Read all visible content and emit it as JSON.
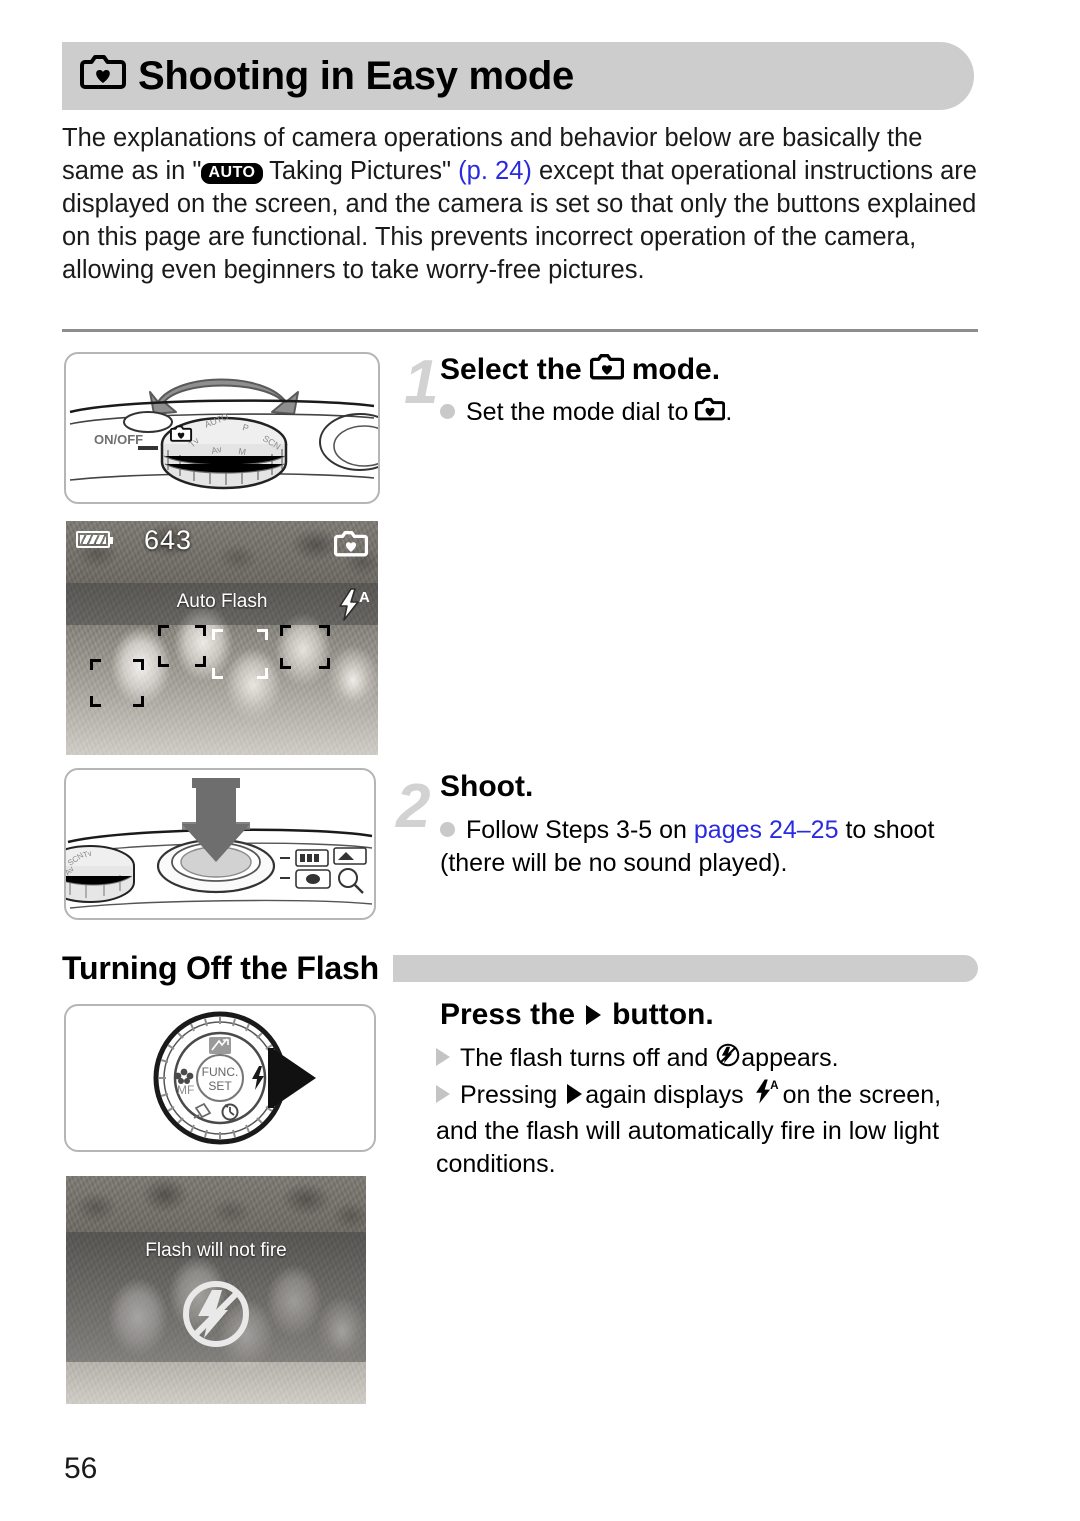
{
  "header": {
    "icon": "easy-mode-camera-heart-icon",
    "title": "Shooting in Easy mode"
  },
  "intro": {
    "part1": "The explanations of camera operations and behavior below are basically the same as in \"",
    "auto_badge": "AUTO",
    "part2": " Taking Pictures\" ",
    "link": "(p. 24)",
    "part3": " except that operational instructions are displayed on the screen, and the camera is set so that only the buttons explained on this page are functional. This prevents incorrect operation of the camera, allowing even beginners to take worry-free pictures."
  },
  "steps": [
    {
      "number": "1",
      "title_before": "Select the",
      "title_icon": "easy-mode-camera-heart-icon",
      "title_after": "mode.",
      "bullet_before": "Set the mode dial to",
      "bullet_icon": "easy-mode-camera-heart-icon",
      "bullet_after": "."
    },
    {
      "number": "2",
      "title": "Shoot.",
      "bullet_before": "Follow Steps 3-5 on ",
      "bullet_link": "pages 24–25",
      "bullet_after": " to shoot (there will be no sound played)."
    }
  ],
  "illustrations": {
    "mode_dial": {
      "name": "mode-dial-illustration",
      "on_off_label": "ON/OFF"
    },
    "shutter": {
      "name": "shutter-button-illustration"
    },
    "control_wheel": {
      "name": "control-wheel-illustration",
      "center_label_top": "FUNC.",
      "center_label_bottom": "SET",
      "left_label": "MF"
    }
  },
  "lcd_auto_flash": {
    "shots_remaining": "643",
    "battery": "battery-full-icon",
    "mode_icon": "easy-mode-camera-heart-icon",
    "flash_icon": "flash-auto-icon",
    "message": "Auto Flash"
  },
  "lcd_no_flash": {
    "message": "Flash will not fire",
    "icon": "flash-off-icon"
  },
  "flash_section": {
    "heading": "Turning Off the Flash",
    "step_title_before": "Press the",
    "step_title_icon": "right-arrow-button-icon",
    "step_title_after": "button.",
    "bullets": [
      {
        "before": "The flash turns off and",
        "icon": "flash-off-icon",
        "after": "appears."
      },
      {
        "before": "Pressing",
        "icon": "right-arrow-button-icon",
        "mid": "again displays",
        "icon2": "flash-auto-icon",
        "after": "on the screen, and the flash will automatically fire in low light conditions."
      }
    ]
  },
  "footer": {
    "page_number": "56"
  },
  "colors": {
    "header_bar": "#cdcdcd",
    "link": "#2a2ae0",
    "step_number": "#d2d2d2",
    "bullet": "#c9c9c9"
  }
}
